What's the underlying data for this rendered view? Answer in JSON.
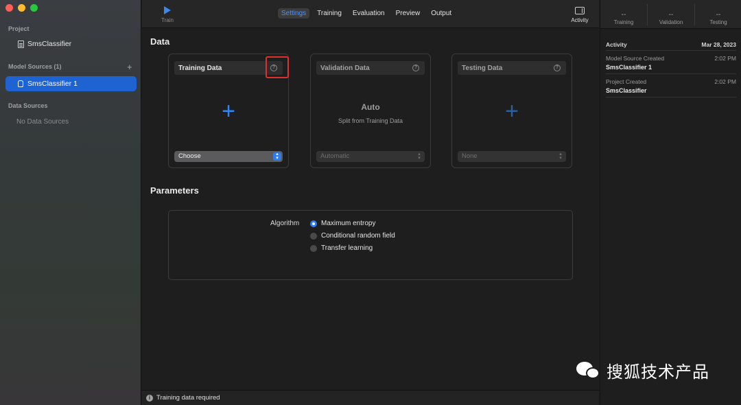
{
  "window": {
    "controls": [
      "close",
      "minimize",
      "maximize"
    ]
  },
  "sidebar": {
    "project_header": "Project",
    "project_item": "SmsClassifier",
    "model_sources_header": "Model Sources (1)",
    "model_source_item": "SmsClassifier 1",
    "add_button": "+",
    "data_sources_header": "Data Sources",
    "data_sources_empty": "No Data Sources"
  },
  "toolbar": {
    "train_label": "Train",
    "tabs": [
      "Settings",
      "Training",
      "Evaluation",
      "Preview",
      "Output"
    ],
    "active_tab": "Settings",
    "activity_label": "Activity"
  },
  "data_section": {
    "title": "Data",
    "training": {
      "title": "Training Data",
      "plus": "+",
      "select_value": "Choose"
    },
    "validation": {
      "title": "Validation Data",
      "auto_title": "Auto",
      "auto_subtitle": "Split from Training Data",
      "select_value": "Automatic"
    },
    "testing": {
      "title": "Testing Data",
      "plus": "+",
      "select_value": "None"
    }
  },
  "parameters": {
    "title": "Parameters",
    "algorithm_label": "Algorithm",
    "options": [
      "Maximum entropy",
      "Conditional random field",
      "Transfer learning"
    ],
    "selected": "Maximum entropy"
  },
  "status": {
    "message": "Training data required"
  },
  "metrics": [
    {
      "value": "--",
      "label": "Training"
    },
    {
      "value": "--",
      "label": "Validation"
    },
    {
      "value": "--",
      "label": "Testing"
    }
  ],
  "activity": {
    "header": "Activity",
    "date": "Mar 28, 2023",
    "entries": [
      {
        "event": "Model Source Created",
        "time": "2:02 PM",
        "name": "SmsClassifier 1"
      },
      {
        "event": "Project Created",
        "time": "2:02 PM",
        "name": "SmsClassifier"
      }
    ]
  },
  "watermark": {
    "text": "搜狐技术产品"
  },
  "colors": {
    "accent": "#2f7cf0",
    "highlight": "#e0302b",
    "selection": "#1f63d3"
  }
}
